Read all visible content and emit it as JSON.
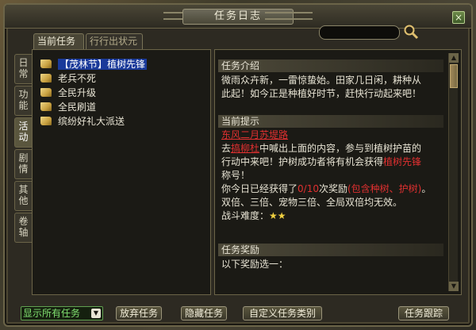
{
  "window": {
    "title": "任务日志",
    "close_label": "×"
  },
  "tabs": [
    {
      "label": "当前任务"
    },
    {
      "label": "行行出状元"
    }
  ],
  "side_tabs": [
    "日常",
    "功能",
    "活动",
    "剧情",
    "其他",
    "卷轴"
  ],
  "quests": [
    "【茂林节】植树先锋",
    "老兵不死",
    "全民升级",
    "全民刷道",
    "缤纷好礼大派送"
  ],
  "detail": {
    "intro_head": "任务介绍",
    "intro_line1": "微雨众卉新，一雷惊蛰始。田家几日闲，耕种从",
    "intro_line2": "此起！如今正是种植好时节，赶快行动起来吧！",
    "hint_head": "当前提示",
    "hint_link": "东风二月苏堤路",
    "hint_p1": "去",
    "hint_npc": "搞柳杜",
    "hint_p2": "中喊出上面的内容，参与到植树护苗的",
    "hint_p3": "行动中来吧！护树成功者将有机会获得",
    "hint_reward": "植树先锋",
    "hint_p4": "称号！",
    "hint_p5": "你今日已经获得了",
    "hint_count": "0/10",
    "hint_p6": "次奖励",
    "hint_note": "(包含种树、护树)",
    "hint_p7": "。",
    "hint_p8": "双倍、三倍、宠物三倍、全局双倍均无效。",
    "difficulty_label": "战斗难度：",
    "difficulty_stars": "★★",
    "reward_head": "任务奖励",
    "reward_text": "以下奖励选一："
  },
  "footer": {
    "filter": "显示所有任务",
    "abandon": "放弃任务",
    "hide": "隐藏任务",
    "custom": "自定义任务类别",
    "track": "任务跟踪"
  }
}
